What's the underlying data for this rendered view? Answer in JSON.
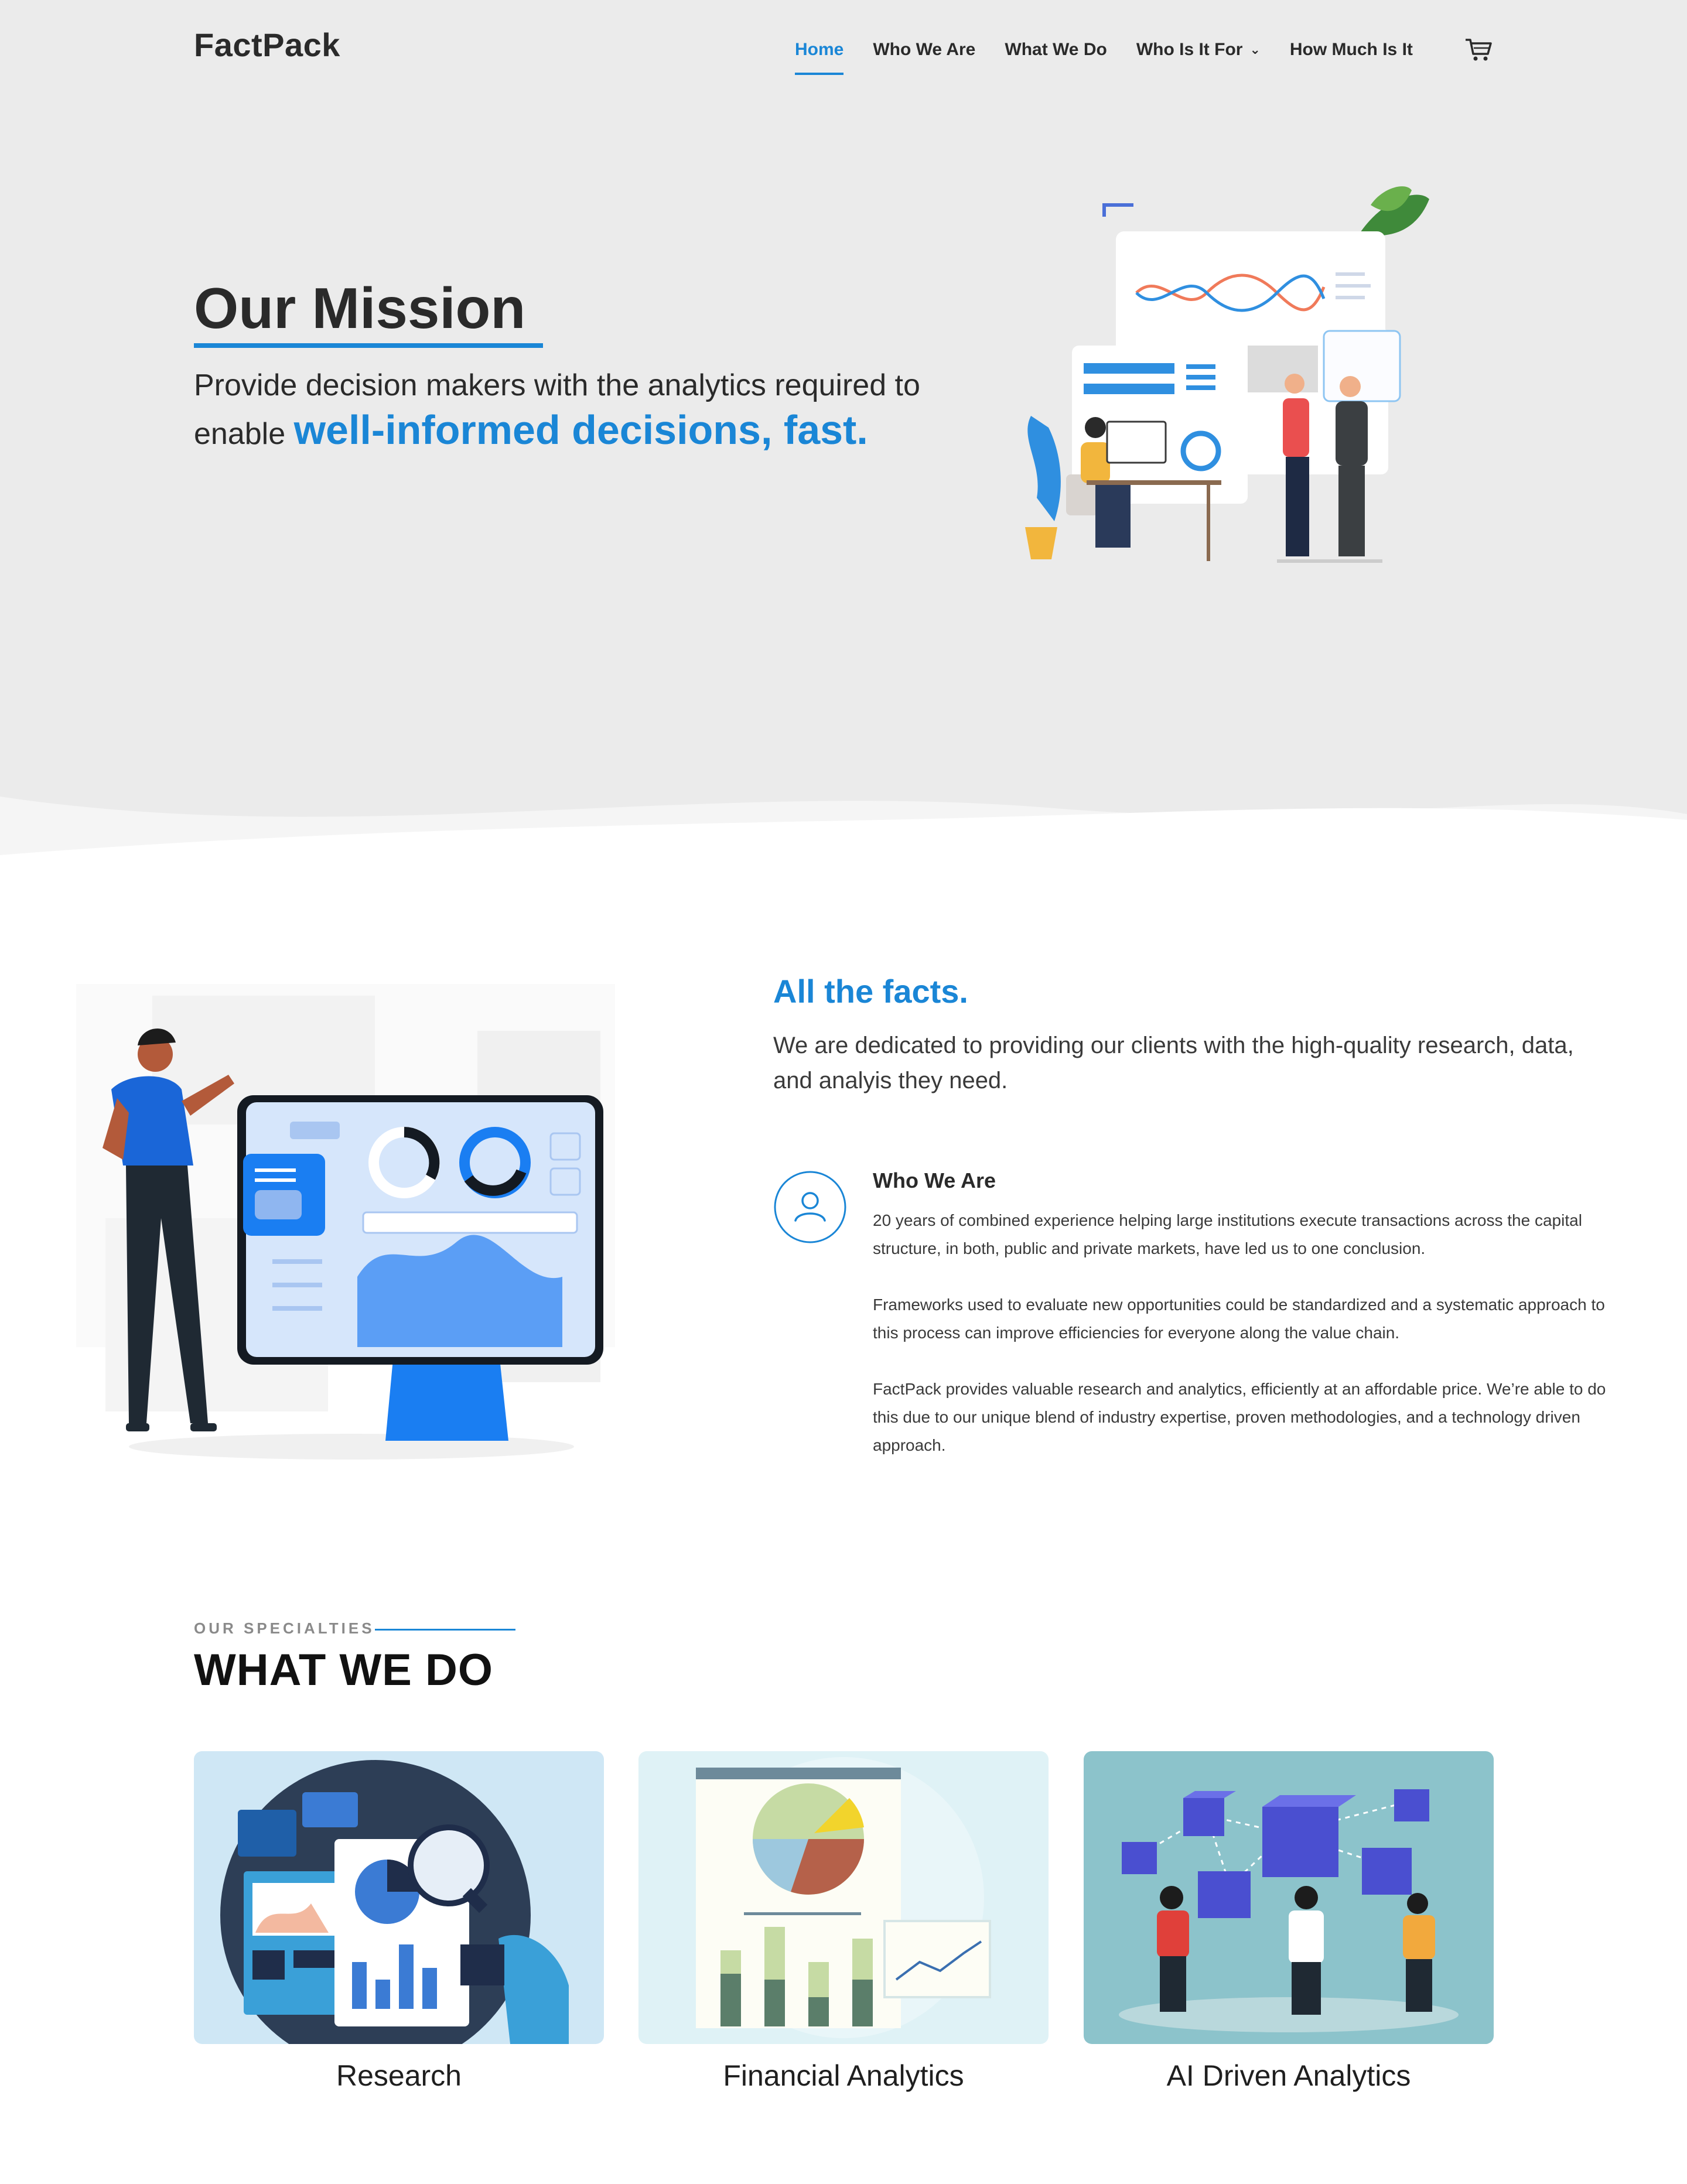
{
  "header": {
    "logo": "FactPack",
    "nav": [
      {
        "label": "Home",
        "active": true
      },
      {
        "label": "Who We Are"
      },
      {
        "label": "What We Do"
      },
      {
        "label": "Who Is It For",
        "has_dropdown": true
      },
      {
        "label": "How Much Is It"
      }
    ],
    "cart_icon": "shopping-cart-icon"
  },
  "hero": {
    "title": "Our Mission",
    "text_prefix": "Provide decision makers with the analytics required to enable",
    "text_highlight": "well-informed decisions, fast."
  },
  "facts": {
    "title": "All the facts.",
    "text": "We are dedicated to providing our clients with the high-quality research, data, and analyis they need.",
    "who": {
      "icon": "user-icon",
      "title": "Who We Are",
      "paragraphs": [
        "20 years of combined experience helping large institutions execute transactions across the capital structure, in both, public and private markets, have led us to one conclusion.",
        "Frameworks used to evaluate new opportunities could be standardized and a systematic approach to this process can improve efficiencies for everyone along the value chain.",
        "FactPack provides valuable research and analytics, efficiently at an affordable price. We’re able to do this due to our unique blend of industry expertise, proven methodologies, and a technology driven approach."
      ]
    }
  },
  "specialties": {
    "eyebrow": "OUR SPECIALTIES",
    "title": "WHAT WE DO",
    "cards": [
      {
        "label": "Research",
        "bg": "#cfe7f5"
      },
      {
        "label": "Financial Analytics",
        "bg": "#dff2f6"
      },
      {
        "label": "AI Driven Analytics",
        "bg": "#8cc3cb"
      }
    ]
  },
  "colors": {
    "accent": "#1a86d6",
    "hero_bg": "#ebebeb"
  }
}
